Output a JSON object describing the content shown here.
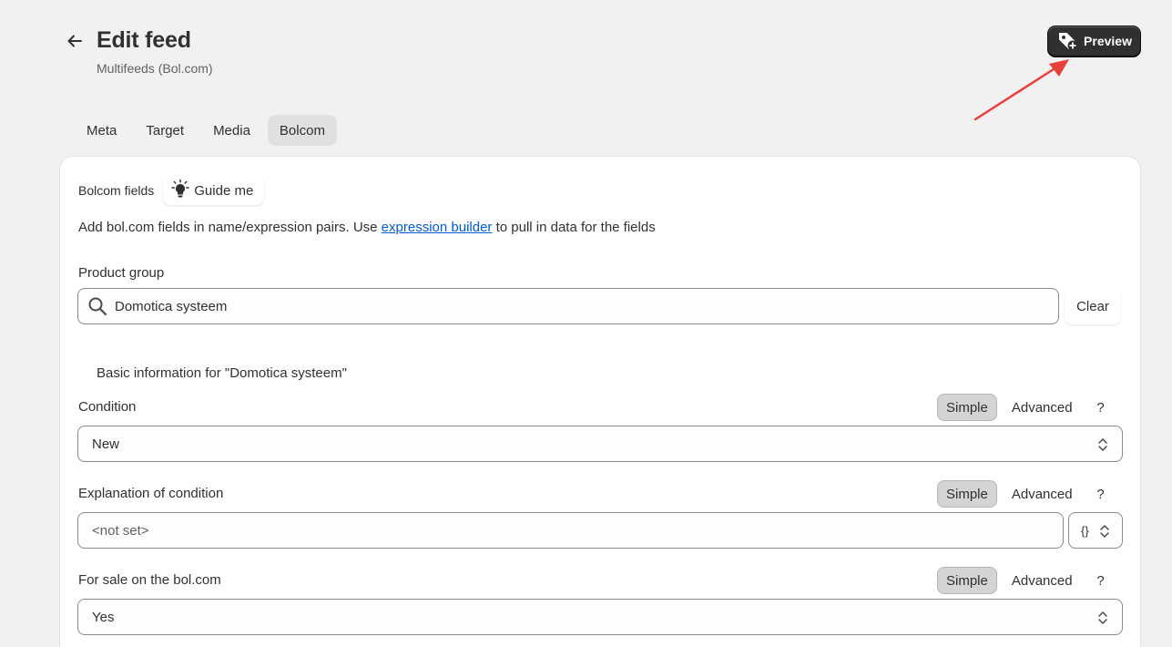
{
  "header": {
    "title": "Edit feed",
    "subtitle": "Multifeeds (Bol.com)",
    "preview_label": "Preview"
  },
  "tabs": [
    {
      "label": "Meta",
      "active": false
    },
    {
      "label": "Target",
      "active": false
    },
    {
      "label": "Media",
      "active": false
    },
    {
      "label": "Bolcom",
      "active": true
    }
  ],
  "card": {
    "fields_label": "Bolcom fields",
    "guide_label": "Guide me",
    "description_prefix": "Add bol.com fields in name/expression pairs. Use ",
    "description_link": "expression builder",
    "description_suffix": " to pull in data for the fields",
    "product_group": {
      "label": "Product group",
      "value": "Domotica systeem",
      "clear_label": "Clear"
    },
    "section_title": "Basic information for \"Domotica systeem\"",
    "fields": [
      {
        "label": "Condition",
        "value": "New",
        "type": "select"
      },
      {
        "label": "Explanation of condition",
        "placeholder": "<not set>",
        "type": "text",
        "expr_symbol": "{}"
      },
      {
        "label": "For sale on the bol.com",
        "value": "Yes",
        "type": "select"
      }
    ],
    "modes": {
      "simple": "Simple",
      "advanced": "Advanced",
      "help": "?"
    }
  },
  "colors": {
    "link": "#005bd3",
    "annotation": "#e8413c",
    "primary_button": "#303030"
  }
}
